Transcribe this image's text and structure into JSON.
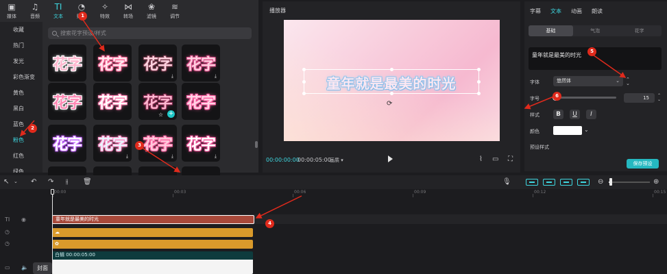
{
  "toolbar": {
    "items": [
      {
        "label": "媒体",
        "icon": "media-icon",
        "glyph": "▣"
      },
      {
        "label": "音频",
        "icon": "audio-icon",
        "glyph": "♫"
      },
      {
        "label": "文本",
        "icon": "text-icon",
        "glyph": "TI"
      },
      {
        "label": "贴纸",
        "icon": "sticker-icon",
        "glyph": "◔"
      },
      {
        "label": "特效",
        "icon": "effects-icon",
        "glyph": "✧"
      },
      {
        "label": "转场",
        "icon": "transition-icon",
        "glyph": "⋈"
      },
      {
        "label": "滤镜",
        "icon": "filter-icon",
        "glyph": "❀"
      },
      {
        "label": "调节",
        "icon": "adjust-icon",
        "glyph": "≋"
      }
    ],
    "active": "文本"
  },
  "categories": [
    "收藏",
    "热门",
    "发光",
    "彩色渐变",
    "黄色",
    "黑白",
    "蓝色",
    "粉色",
    "红色",
    "绿色"
  ],
  "active_category": "粉色",
  "search": {
    "placeholder": "搜索花字预设/样式"
  },
  "effect_tiles": [
    {
      "text": "花字",
      "color": "#ffb7cf",
      "shadow": "#ffffff",
      "download": false
    },
    {
      "text": "花字",
      "color": "#ffe9f0",
      "shadow": "#ff6b9a",
      "download": false
    },
    {
      "text": "花字",
      "color": "#ffd3e0",
      "shadow": "#7a3b4e",
      "download": true
    },
    {
      "text": "花字",
      "color": "#ffcfe0",
      "shadow": "#d64d86",
      "download": true
    },
    {
      "text": "花字",
      "color": "#ff8ab5",
      "shadow": "#ffffff",
      "download": false
    },
    {
      "text": "花字",
      "color": "#ffffff",
      "shadow": "#ff7fb0",
      "download": false
    },
    {
      "text": "花字",
      "color": "#ffb6d0",
      "shadow": "#8a2b51",
      "download": false,
      "star": true,
      "plus": true
    },
    {
      "text": "花字",
      "color": "#ffd4e6",
      "shadow": "#ff5fa2",
      "download": false
    },
    {
      "text": "花字",
      "color": "#ffffff",
      "shadow": "#c56bff",
      "download": false
    },
    {
      "text": "花字",
      "color": "#e9f4ff",
      "shadow": "#ff8dc3",
      "download": true
    },
    {
      "text": "花字",
      "color": "#ffc9dc",
      "shadow": "#ff6aa5",
      "download": true
    },
    {
      "text": "花字",
      "color": "#ffffff",
      "shadow": "#f0569a",
      "download": true
    },
    {
      "text": "",
      "color": "#ffffff",
      "shadow": "#ffffff",
      "download": false
    },
    {
      "text": "",
      "color": "#ffffff",
      "shadow": "#ffffff",
      "download": false
    },
    {
      "text": "",
      "color": "#ffffff",
      "shadow": "#ffffff",
      "download": false
    },
    {
      "text": "",
      "color": "#ffffff",
      "shadow": "#ffffff",
      "download": false
    }
  ],
  "player": {
    "title": "播放器",
    "overlay_text": "童年就是最美的时光",
    "current_time": "00:00:00:00",
    "total_time": "00:00:05:00",
    "ratio": "画质"
  },
  "props": {
    "tabs": [
      "字幕",
      "文本",
      "动画",
      "朗读"
    ],
    "active_tab": "文本",
    "subtabs": [
      "基础",
      "气泡",
      "花字"
    ],
    "active_subtab": "基础",
    "text_value": "童年就是最美的时光",
    "font_label": "字体",
    "font_value": "悠然体",
    "size_label": "字号",
    "size_value": "15",
    "style_label": "样式",
    "style_buttons": [
      "B",
      "U",
      "I"
    ],
    "color_label": "颜色",
    "color_value": "#ffffff",
    "preset_label": "预设样式",
    "save_label": "保存预设"
  },
  "timeline": {
    "ruler_labels": [
      "00:00",
      "00:03",
      "00:06",
      "00:09",
      "00:12",
      "00:15"
    ],
    "text_clip": "童年就是最美的时光",
    "video_clip_label": "白辑  00:00:05:00",
    "cover_label": "封面"
  },
  "annotations": [
    "1",
    "2",
    "3",
    "4",
    "5",
    "6"
  ],
  "accent_color": "#3ed7e0",
  "annotation_color": "#e02a1c"
}
